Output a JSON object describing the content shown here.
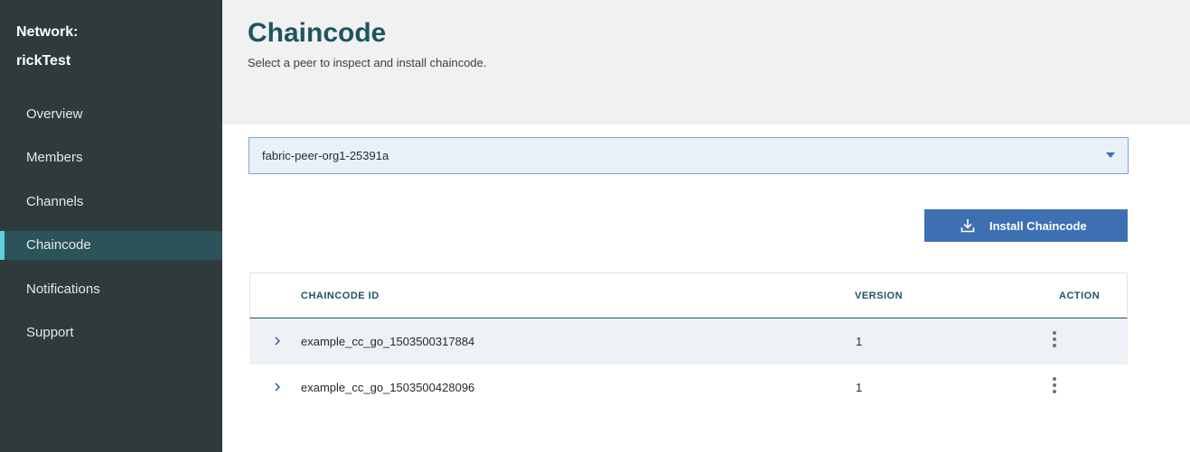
{
  "sidebar": {
    "network_label": "Network:",
    "network_name": "rickTest",
    "items": [
      {
        "label": "Overview"
      },
      {
        "label": "Members"
      },
      {
        "label": "Channels"
      },
      {
        "label": "Chaincode"
      },
      {
        "label": "Notifications"
      },
      {
        "label": "Support"
      }
    ]
  },
  "header": {
    "title": "Chaincode",
    "subtitle": "Select a peer to inspect and install chaincode."
  },
  "peer_select": {
    "selected": "fabric-peer-org1-25391a"
  },
  "install_button": {
    "label": "Install Chaincode",
    "icon": "download-icon"
  },
  "table": {
    "columns": {
      "id": "CHAINCODE ID",
      "version": "VERSION",
      "action": "ACTION"
    },
    "rows": [
      {
        "id": "example_cc_go_1503500317884",
        "version": "1"
      },
      {
        "id": "example_cc_go_1503500428096",
        "version": "1"
      }
    ]
  },
  "colors": {
    "sidebar_bg": "#2f3a3c",
    "active_nav_bg": "#2b5359",
    "active_indicator": "#5fd0dc",
    "title": "#1d5560",
    "primary_button": "#3d70b2"
  }
}
